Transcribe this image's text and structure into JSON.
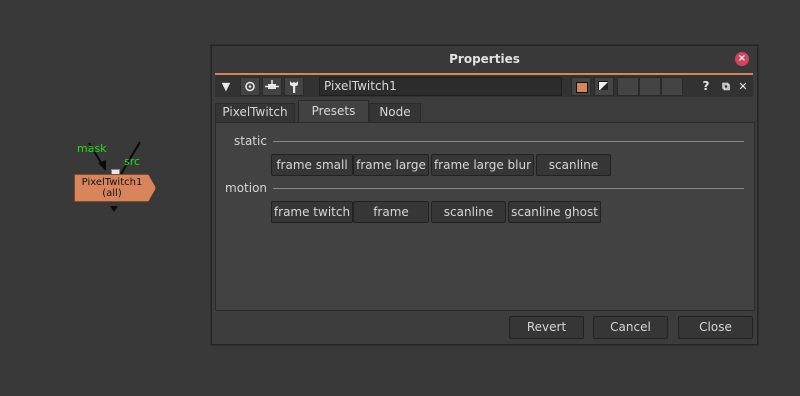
{
  "node_graph": {
    "node_name": "PixelTwitch1",
    "node_channels": "(all)",
    "inputs": {
      "mask": "mask",
      "src": "src"
    },
    "node_color": "#d8855c"
  },
  "properties": {
    "title": "Properties",
    "close_glyph": "×",
    "toolbar": {
      "collapse_glyph": "▼",
      "node_name_value": "PixelTwitch1",
      "help_glyph": "?",
      "float_glyph": "⧉",
      "close_glyph": "✕"
    },
    "tabs": [
      {
        "label": "PixelTwitch"
      },
      {
        "label": "Presets"
      },
      {
        "label": "Node"
      }
    ],
    "groups": {
      "static": {
        "label": "static",
        "buttons": [
          "frame small",
          "frame large",
          "frame large blur",
          "scanline"
        ]
      },
      "motion": {
        "label": "motion",
        "buttons": [
          "frame twitch",
          "frame",
          "scanline",
          "scanline ghost"
        ]
      }
    },
    "footer": {
      "revert": "Revert",
      "cancel": "Cancel",
      "close": "Close"
    }
  }
}
